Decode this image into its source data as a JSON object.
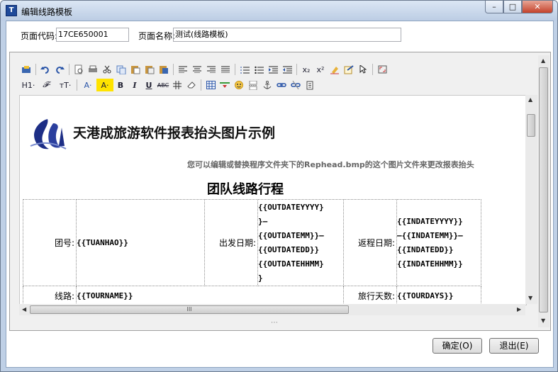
{
  "window": {
    "title": "编辑线路模板",
    "app_icon": "T",
    "controls": {
      "minimize": "–",
      "maximize": "□",
      "close": "✕"
    }
  },
  "form": {
    "page_code_label": "页面代码:",
    "page_code_value": "17CE650001",
    "page_name_label": "页面名称:",
    "page_name_value": "测试(线路模板)"
  },
  "toolbar": {
    "row1_icons": [
      "paste-text-icon",
      "undo-icon",
      "redo-icon",
      "preview-icon",
      "print-icon",
      "cut-icon",
      "copy-icon",
      "paste-icon",
      "paste-plain-icon",
      "paste-word-icon",
      "align-left-icon",
      "align-center-icon",
      "align-right-icon",
      "align-justify-icon",
      "ordered-list-icon",
      "unordered-list-icon",
      "indent-icon",
      "outdent-icon",
      "subscript-icon",
      "superscript-icon",
      "clear-format-icon",
      "select-all-icon",
      "pointer-icon",
      "fullscreen-icon"
    ],
    "subscript": "x₂",
    "superscript": "x²",
    "heading": "H1·",
    "font_family": "𝓕·",
    "font_size": "тT·",
    "font_color": "A·",
    "highlight": "A·",
    "bold": "B",
    "italic": "I",
    "underline": "U",
    "strikethrough": "ABC"
  },
  "document": {
    "headline": "天港成旅游软件报表抬头图片示例",
    "note": "您可以编辑或替换程序文件夹下的Rephead.bmp的这个图片文件来更改报表抬头",
    "table_title": "团队线路行程",
    "rows": {
      "tuan_label": "团号:",
      "tuan_value": "{{TUANHAO}}",
      "depart_label": "出发日期:",
      "depart_value": [
        "{{OUTDATEYYYY}",
        "}–",
        "{{OUTDATEMM}}–",
        "{{OUTDATEDD}}",
        "{{OUTDATEHHMM}",
        "}"
      ],
      "return_label": "返程日期:",
      "return_value": [
        "{{INDATEYYYY}}",
        "–{{INDATEMM}}–",
        "{{INDATEDD}}",
        "{{INDATEHHMM}}"
      ],
      "route_label": "线路:",
      "route_value": "{{TOURNAME}}",
      "days_label": "旅行天数:",
      "days_value": "{{TOURDAYS}}"
    }
  },
  "scroll": {
    "h_thumb_grip": "III",
    "resize_grip": "⋯"
  },
  "buttons": {
    "ok": "确定(O)",
    "exit": "退出(E)"
  },
  "colors": {
    "title_gradient_top": "#dbe6f4",
    "logo_blue": "#1d2e86",
    "close_red": "#c4422b"
  }
}
